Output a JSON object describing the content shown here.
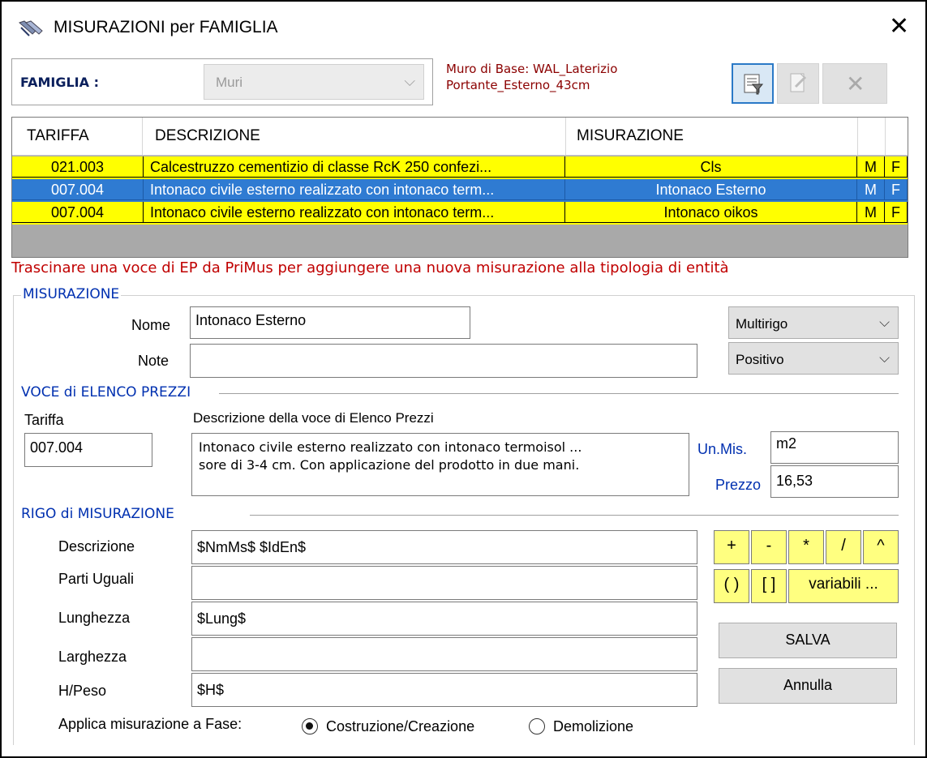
{
  "window": {
    "title": "MISURAZIONI per FAMIGLIA"
  },
  "famiglia": {
    "label": "FAMIGLIA :",
    "value": "Muri"
  },
  "muro_info": {
    "line1": "Muro di Base: WAL_Laterizio",
    "line2": "Portante_Esterno_43cm"
  },
  "toolbar": {
    "close_label": "✕"
  },
  "grid": {
    "columns": [
      "TARIFFA",
      "DESCRIZIONE",
      "MISURAZIONE",
      "",
      ""
    ],
    "rows": [
      {
        "tariffa": "021.003",
        "descrizione": "Calcestruzzo cementizio di classe RcK 250 confezi...",
        "misurazione": "Cls",
        "m": "M",
        "f": "F",
        "style": "yellow"
      },
      {
        "tariffa": "007.004",
        "descrizione": "Intonaco civile esterno realizzato con intonaco term...",
        "misurazione": "Intonaco Esterno",
        "m": "M",
        "f": "F",
        "style": "blue"
      },
      {
        "tariffa": "007.004",
        "descrizione": "Intonaco civile esterno realizzato con intonaco term...",
        "misurazione": "Intonaco oikos",
        "m": "M",
        "f": "F",
        "style": "yellow"
      }
    ]
  },
  "drag_hint": "Trascinare una voce di EP da PriMus per aggiungere una nuova misurazione alla tipologia di entità",
  "misurazione": {
    "section": "MISURAZIONE",
    "nome_label": "Nome",
    "nome_value": "Intonaco Esterno",
    "note_label": "Note",
    "note_value": "",
    "tipo": "Multirigo",
    "segno": "Positivo"
  },
  "voce": {
    "section": "VOCE di ELENCO PREZZI",
    "tariffa_label": "Tariffa",
    "tariffa_value": "007.004",
    "desc_label": "Descrizione della voce di Elenco Prezzi",
    "desc_line1": "Intonaco civile esterno realizzato con intonaco termoisol ...",
    "desc_line2": "sore di 3-4 cm. Con applicazione del prodotto in due mani.",
    "unmis_label": "Un.Mis.",
    "unmis_value": "m2",
    "prezzo_label": "Prezzo",
    "prezzo_value": "16,53"
  },
  "rigo": {
    "section": "RIGO di MISURAZIONE",
    "descrizione_label": "Descrizione",
    "descrizione_value": "$NmMs$ $IdEn$",
    "parti_label": "Parti Uguali",
    "parti_value": "",
    "lunghezza_label": "Lunghezza",
    "lunghezza_value": "$Lung$",
    "larghezza_label": "Larghezza",
    "larghezza_value": "",
    "hpeso_label": "H/Peso",
    "hpeso_value": "$H$"
  },
  "operators": {
    "plus": "+",
    "minus": "-",
    "mul": "*",
    "div": "/",
    "pow": "^",
    "paren": "( )",
    "bracket": "[ ]",
    "variabili": "variabili ..."
  },
  "actions": {
    "salva": "SALVA",
    "annulla": "Annulla"
  },
  "fase": {
    "label": "Applica misurazione a Fase:",
    "opt1": "Costruzione/Creazione",
    "opt2": "Demolizione",
    "selected": "Costruzione/Creazione"
  }
}
